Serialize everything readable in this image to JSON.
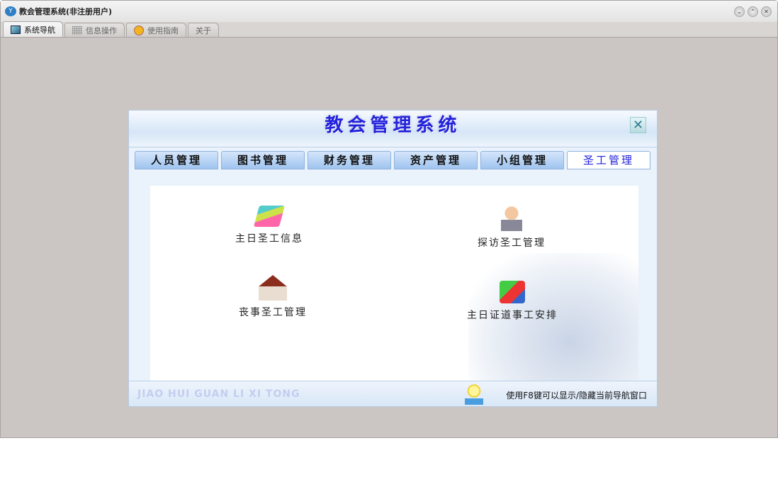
{
  "window": {
    "title": "教会管理系统(非注册用户)",
    "controls": [
      "minimize",
      "maximize",
      "close"
    ]
  },
  "top_tabs": [
    {
      "label": "系统导航",
      "icon": "monitor-icon",
      "active": true
    },
    {
      "label": "信息操作",
      "icon": "grid-icon"
    },
    {
      "label": "使用指南",
      "icon": "help-icon"
    },
    {
      "label": "关于"
    }
  ],
  "panel": {
    "title": "教会管理系统",
    "tabs": [
      {
        "label": "人员管理"
      },
      {
        "label": "图书管理"
      },
      {
        "label": "财务管理"
      },
      {
        "label": "资产管理"
      },
      {
        "label": "小组管理"
      },
      {
        "label": "圣工管理",
        "active": true
      }
    ],
    "items": [
      {
        "label": "主日圣工信息",
        "icon": "books-icon"
      },
      {
        "label": "探访圣工管理",
        "icon": "person-icon"
      },
      {
        "label": "丧事圣工管理",
        "icon": "church-icon"
      },
      {
        "label": "主日证道事工安排",
        "icon": "folder-icon"
      }
    ],
    "footer_brand": "JIAO HUI GUAN LI XI TONG",
    "footer_hint": "使用F8键可以显示/隐藏当前导航窗口"
  }
}
